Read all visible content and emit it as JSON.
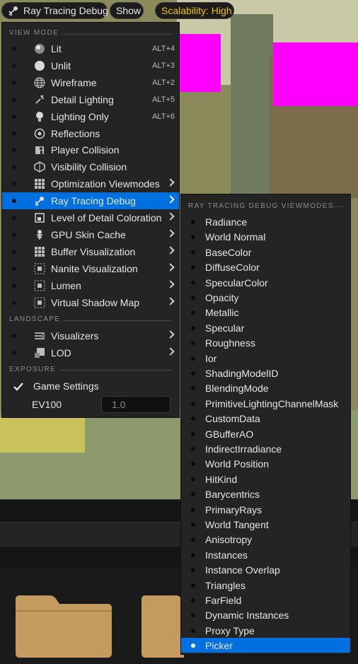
{
  "toolbar": {
    "viewmode_label": "Ray Tracing Debug",
    "show_label": "Show",
    "scalability_label": "Scalability: High"
  },
  "menu": {
    "view_mode_header": "VIEW MODE",
    "items": [
      {
        "label": "Lit",
        "shortcut": "ALT+4",
        "icon": "lit-sphere-icon"
      },
      {
        "label": "Unlit",
        "shortcut": "ALT+3",
        "icon": "unlit-sphere-icon"
      },
      {
        "label": "Wireframe",
        "shortcut": "ALT+2",
        "icon": "wireframe-sphere-icon"
      },
      {
        "label": "Detail Lighting",
        "shortcut": "ALT+5",
        "icon": "detail-lighting-icon"
      },
      {
        "label": "Lighting Only",
        "shortcut": "ALT+6",
        "icon": "bulb-icon"
      },
      {
        "label": "Reflections",
        "shortcut": "",
        "icon": "reflection-icon"
      },
      {
        "label": "Player Collision",
        "shortcut": "",
        "icon": "player-collision-icon"
      },
      {
        "label": "Visibility Collision",
        "shortcut": "",
        "icon": "visibility-collision-icon"
      },
      {
        "label": "Optimization Viewmodes",
        "shortcut": "",
        "icon": "grid-icon"
      },
      {
        "label": "Ray Tracing Debug",
        "shortcut": "",
        "icon": "ray-tracing-icon"
      },
      {
        "label": "Level of Detail Coloration",
        "shortcut": "",
        "icon": "lod-icon"
      },
      {
        "label": "GPU Skin Cache",
        "shortcut": "",
        "icon": "skeleton-icon"
      },
      {
        "label": "Buffer Visualization",
        "shortcut": "",
        "icon": "buffer-grid-icon"
      },
      {
        "label": "Nanite Visualization",
        "shortcut": "",
        "icon": "nanite-grid-icon"
      },
      {
        "label": "Lumen",
        "shortcut": "",
        "icon": "lumen-grid-icon"
      },
      {
        "label": "Virtual Shadow Map",
        "shortcut": "",
        "icon": "shadow-grid-icon"
      }
    ],
    "landscape_header": "LANDSCAPE",
    "landscape_items": [
      {
        "label": "Visualizers",
        "icon": "visualizers-icon"
      },
      {
        "label": "LOD",
        "icon": "landscape-lod-icon"
      }
    ],
    "exposure_header": "EXPOSURE",
    "game_settings_label": "Game Settings",
    "game_settings_checked": true,
    "ev100_label": "EV100",
    "ev100_value": "1.0"
  },
  "submenu": {
    "header": "RAY TRACING DEBUG VIEWMODES",
    "items": [
      "Radiance",
      "World Normal",
      "BaseColor",
      "DiffuseColor",
      "SpecularColor",
      "Opacity",
      "Metallic",
      "Specular",
      "Roughness",
      "Ior",
      "ShadingModelID",
      "BlendingMode",
      "PrimitiveLightingChannelMask",
      "CustomData",
      "GBufferAO",
      "IndirectIrradiance",
      "World Position",
      "HitKind",
      "Barycentrics",
      "PrimaryRays",
      "World Tangent",
      "Anisotropy",
      "Instances",
      "Instance Overlap",
      "Triangles",
      "FarField",
      "Dynamic Instances",
      "Proxy Type",
      "Picker"
    ],
    "selected": "Picker"
  },
  "colors": {
    "highlight": "#0070e0",
    "scalability_text": "#f2c200",
    "magenta": "#ff00ff"
  }
}
